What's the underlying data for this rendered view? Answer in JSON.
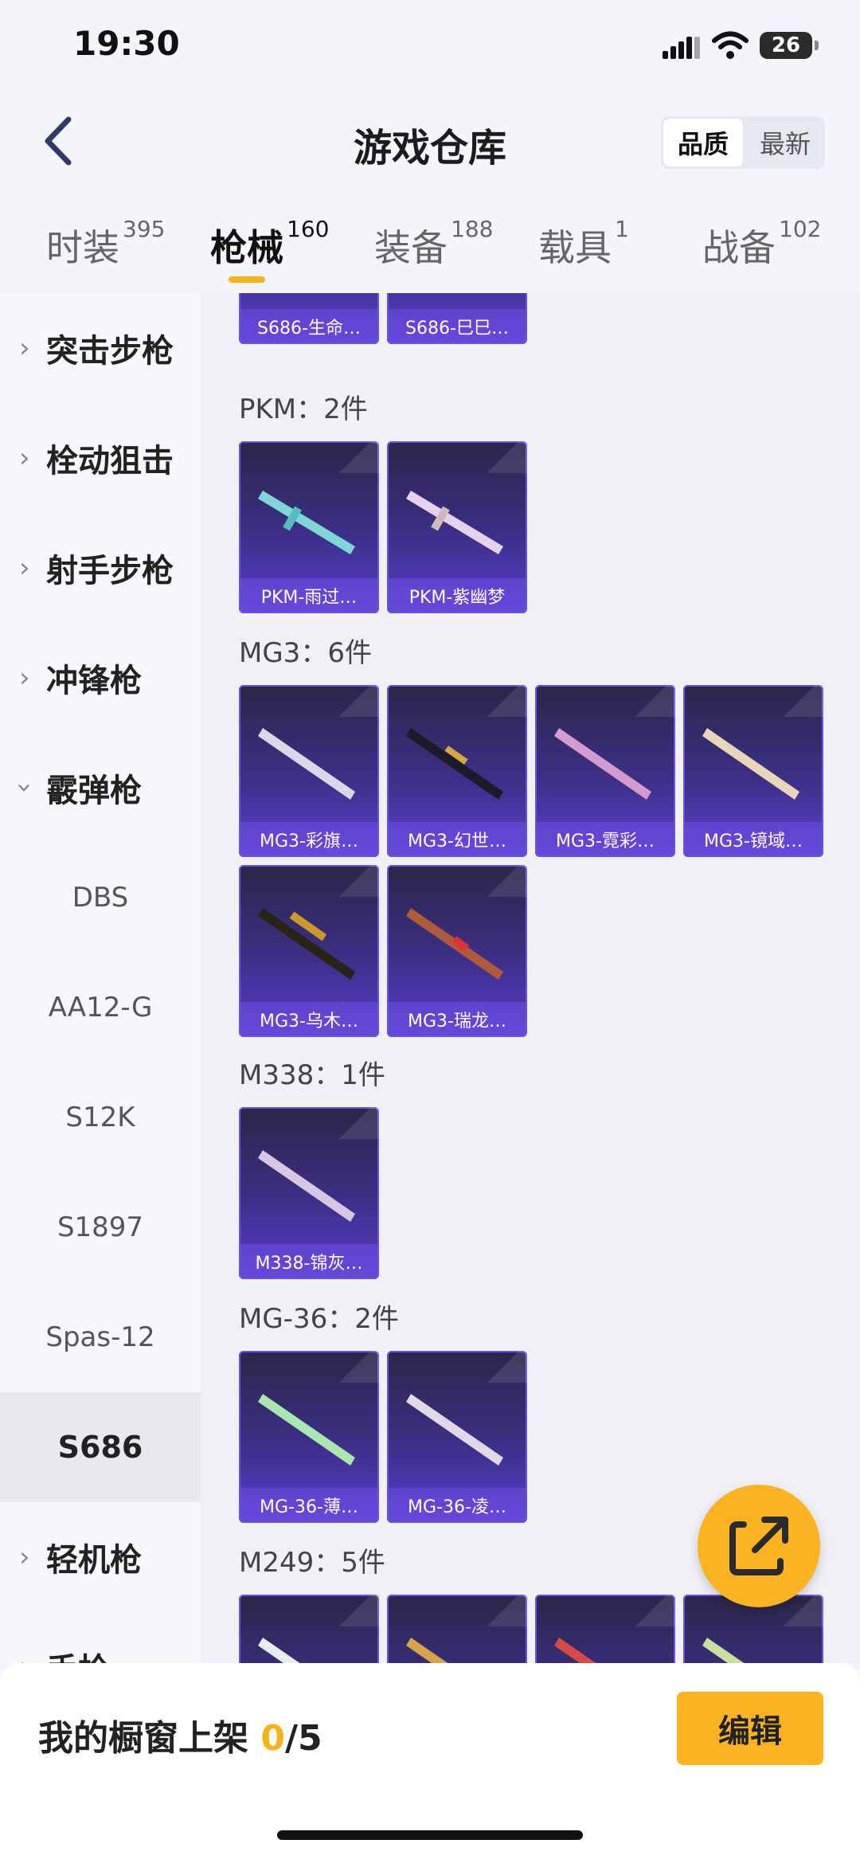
{
  "status": {
    "time": "19:30",
    "battery": "26"
  },
  "header": {
    "title": "游戏仓库",
    "sort": [
      "品质",
      "最新"
    ]
  },
  "tabs": [
    {
      "label": "时装",
      "count": "395"
    },
    {
      "label": "枪械",
      "count": "160"
    },
    {
      "label": "装备",
      "count": "188"
    },
    {
      "label": "载具",
      "count": "1"
    },
    {
      "label": "战备",
      "count": "102"
    }
  ],
  "sidebar": {
    "items": [
      {
        "label": "突击步枪"
      },
      {
        "label": "栓动狙击"
      },
      {
        "label": "射手步枪"
      },
      {
        "label": "冲锋枪"
      },
      {
        "label": "霰弹枪"
      },
      {
        "label": "DBS"
      },
      {
        "label": "AA12-G"
      },
      {
        "label": "S12K"
      },
      {
        "label": "S1897"
      },
      {
        "label": "Spas-12"
      },
      {
        "label": "S686"
      },
      {
        "label": "轻机枪"
      },
      {
        "label": "手枪"
      }
    ]
  },
  "groups": [
    {
      "title": "",
      "items": [
        "S686-生命…",
        "S686-巳巳…"
      ]
    },
    {
      "title": "PKM：2件",
      "items": [
        "PKM-雨过…",
        "PKM-紫幽梦"
      ]
    },
    {
      "title": "MG3：6件",
      "items": [
        "MG3-彩旗…",
        "MG3-幻世…",
        "MG3-霓彩…",
        "MG3-镜域…",
        "MG3-乌木…",
        "MG3-瑞龙…"
      ]
    },
    {
      "title": "M338：1件",
      "items": [
        "M338-锦灰…"
      ]
    },
    {
      "title": "MG-36：2件",
      "items": [
        "MG-36-薄…",
        "MG-36-凌…"
      ]
    },
    {
      "title": "M249：5件",
      "items": []
    }
  ],
  "bottom": {
    "showcase_label": "我的橱窗上架",
    "showcase_count": "0",
    "showcase_total": "/5",
    "edit_label": "编辑"
  }
}
